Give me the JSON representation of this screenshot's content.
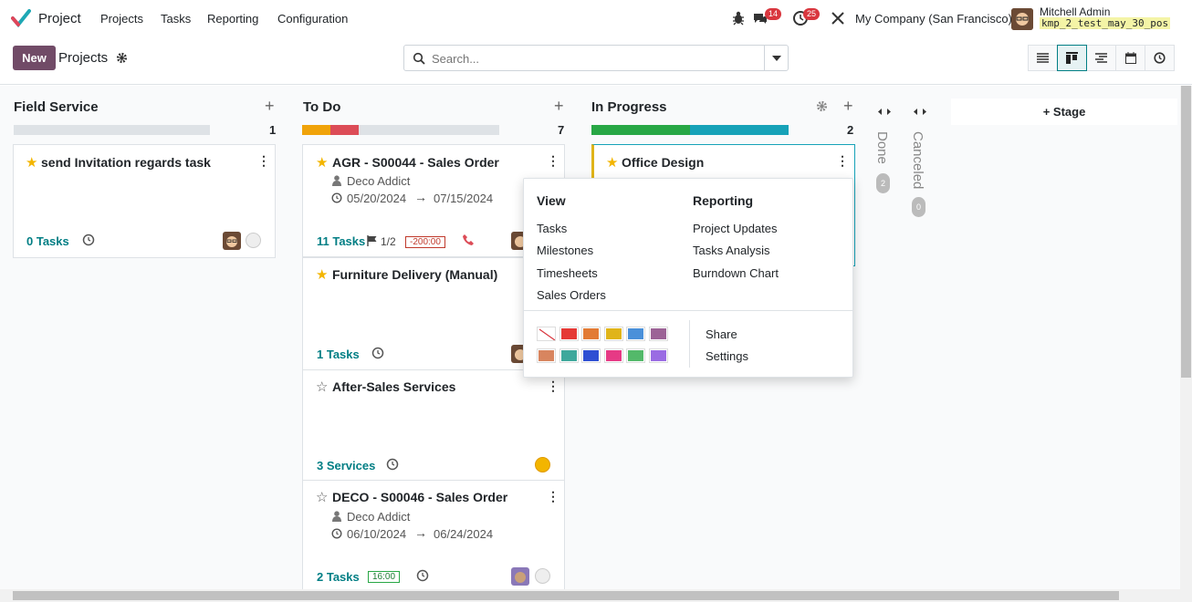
{
  "topbar": {
    "app_name": "Project",
    "menu": [
      "Projects",
      "Tasks",
      "Reporting",
      "Configuration"
    ],
    "chat_badge": "14",
    "activity_badge": "25",
    "company": "My Company (San Francisco)",
    "user_name": "Mitchell Admin",
    "db_name": "kmp_2_test_may_30_pos"
  },
  "control": {
    "new_label": "New",
    "breadcrumb": "Projects",
    "search_placeholder": "Search..."
  },
  "columns": {
    "field_service": {
      "title": "Field Service",
      "count": "1"
    },
    "todo": {
      "title": "To Do",
      "count": "7"
    },
    "in_progress": {
      "title": "In Progress",
      "count": "2"
    },
    "done": {
      "title": "Done",
      "count": "2"
    },
    "canceled": {
      "title": "Canceled",
      "count": "0"
    },
    "add_stage_label": "Stage"
  },
  "cards": {
    "invitation": {
      "title": "send Invitation regards task",
      "link": "0 Tasks"
    },
    "agr": {
      "title": "AGR - S00044 - Sales Order",
      "customer": "Deco Addict",
      "date_start": "05/20/2024",
      "date_end": "07/15/2024",
      "link": "11 Tasks",
      "milestone": "1/2",
      "hours": "-200:00"
    },
    "furniture": {
      "title": "Furniture Delivery (Manual)",
      "link": "1 Tasks"
    },
    "after_sales": {
      "title": "After-Sales Services",
      "link": "3 Services"
    },
    "deco": {
      "title": "DECO - S00046 - Sales Order",
      "customer": "Deco Addict",
      "date_start": "06/10/2024",
      "date_end": "06/24/2024",
      "link": "2 Tasks",
      "hours": "16:00"
    },
    "office": {
      "title": "Office Design"
    }
  },
  "dropdown": {
    "view_title": "View",
    "view_items": [
      "Tasks",
      "Milestones",
      "Timesheets",
      "Sales Orders"
    ],
    "reporting_title": "Reporting",
    "reporting_items": [
      "Project Updates",
      "Tasks Analysis",
      "Burndown Chart"
    ],
    "share_label": "Share",
    "settings_label": "Settings",
    "colors": [
      "#ffffff",
      "#e53935",
      "#e27b35",
      "#e0b419",
      "#4a90d9",
      "#9c6396",
      "#d8855f",
      "#3fa89c",
      "#2e4fd3",
      "#e63a85",
      "#53b96a",
      "#9a6ce3"
    ]
  }
}
